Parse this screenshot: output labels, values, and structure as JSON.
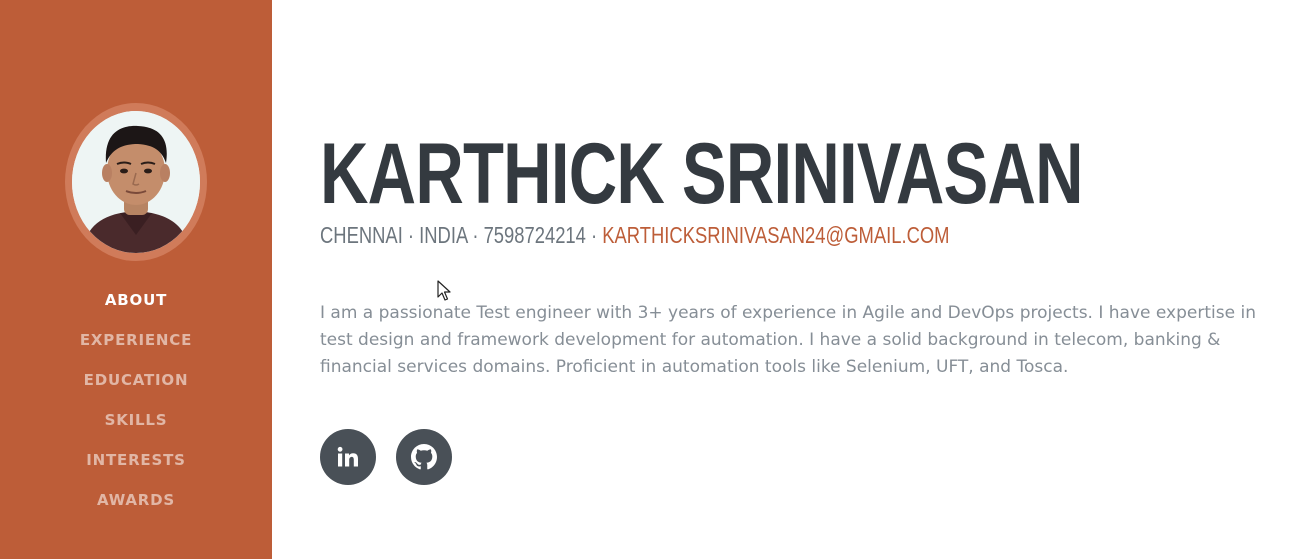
{
  "sidebar": {
    "avatar_alt": "Profile photo",
    "nav": [
      {
        "label": "ABOUT",
        "active": true
      },
      {
        "label": "EXPERIENCE",
        "active": false
      },
      {
        "label": "EDUCATION",
        "active": false
      },
      {
        "label": "SKILLS",
        "active": false
      },
      {
        "label": "INTERESTS",
        "active": false
      },
      {
        "label": "AWARDS",
        "active": false
      }
    ]
  },
  "about": {
    "name": "KARTHICK SRINIVASAN",
    "location": "CHENNAI · INDIA · 7598724214 · ",
    "email": "KARTHICKSRINIVASAN24@GMAIL.COM",
    "bio": "I am a passionate Test engineer with 3+ years of experience in Agile and DevOps projects. I have expertise in test design and framework development for automation. I have a solid background in telecom, banking & financial services domains. Proficient in automation tools like Selenium, UFT, and Tosca.",
    "social": [
      {
        "icon": "linkedin-icon"
      },
      {
        "icon": "github-icon"
      }
    ]
  },
  "colors": {
    "primary": "#bd5d38",
    "heading": "#343a40",
    "muted": "#6c757d",
    "body": "#868e96",
    "social_bg": "#495057"
  }
}
